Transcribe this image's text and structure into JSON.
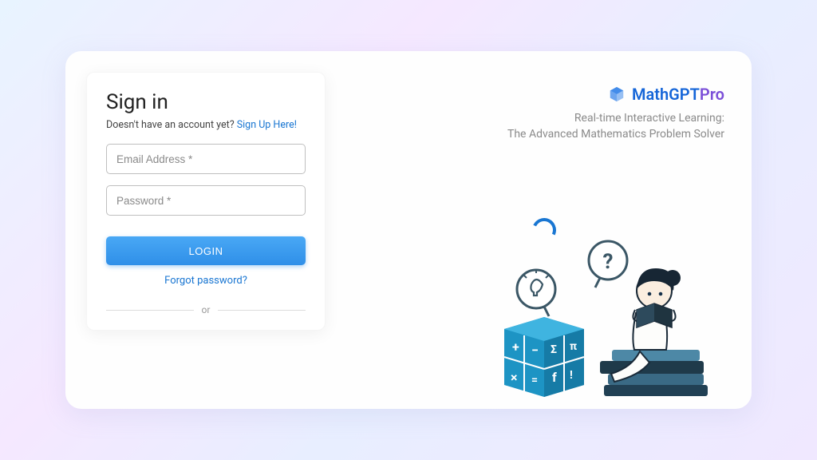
{
  "signin": {
    "title": "Sign in",
    "noaccount": "Doesn't have an account yet? ",
    "signup_link": "Sign Up Here!",
    "email_placeholder": "Email Address *",
    "password_placeholder": "Password *",
    "login_button": "LOGIN",
    "forgot": "Forgot password?",
    "or": "or"
  },
  "brand": {
    "name_a": "MathGPT",
    "name_b": "Pro",
    "tagline_1": "Real-time Interactive Learning:",
    "tagline_2": "The Advanced Mathematics Problem Solver"
  }
}
